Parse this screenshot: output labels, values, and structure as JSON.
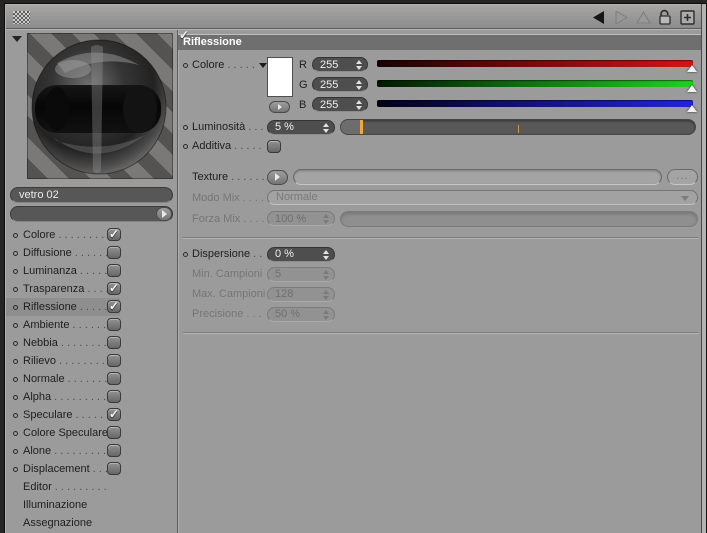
{
  "topbar": {
    "icons": {
      "back": "left-triangle",
      "forward": "right-triangle-disabled",
      "up": "up-triangle-disabled",
      "lock": "open-padlock",
      "add": "plus-box"
    }
  },
  "sidebar": {
    "material_name": "vetro 02",
    "preview": "glass sphere with black cylinder on diagonal stripes",
    "channels": [
      {
        "label": "Colore",
        "dots": ". . . . . . . . .",
        "checked": true
      },
      {
        "label": "Diffusione",
        "dots": ". . . . . .",
        "checked": false
      },
      {
        "label": "Luminanza",
        "dots": ". . . . .",
        "checked": false
      },
      {
        "label": "Trasparenza",
        "dots": ". . . .",
        "checked": true
      },
      {
        "label": "Riflessione",
        "dots": ". . . . .",
        "checked": true,
        "selected": true
      },
      {
        "label": "Ambiente",
        "dots": ". . . . . .",
        "checked": false
      },
      {
        "label": "Nebbia",
        "dots": ". . . . . . . .",
        "checked": false
      },
      {
        "label": "Rilievo",
        "dots": ". . . . . . . .",
        "checked": false
      },
      {
        "label": "Normale",
        "dots": ". . . . . . .",
        "checked": false
      },
      {
        "label": "Alpha",
        "dots": ". . . . . . . . .",
        "checked": false
      },
      {
        "label": "Speculare",
        "dots": ". . . . . .",
        "checked": true
      },
      {
        "label": "Colore Speculare",
        "dots": "",
        "checked": false
      },
      {
        "label": "Alone",
        "dots": ". . . . . . . . .",
        "checked": false
      },
      {
        "label": "Displacement",
        "dots": ". . .",
        "checked": false
      },
      {
        "label": "Editor",
        "dots": ". . . . . . . . ."
      },
      {
        "label": "Illuminazione",
        "dots": ""
      },
      {
        "label": "Assegnazione",
        "dots": ""
      }
    ]
  },
  "panel": {
    "title": "Riflessione",
    "color": {
      "label": "Colore",
      "dots": ". . . . .",
      "swatch_style": "background:#ffffff",
      "r_label": "R",
      "r_value": "255",
      "g_label": "G",
      "g_value": "255",
      "b_label": "B",
      "b_value": "255"
    },
    "luminosita": {
      "label": "Luminosità",
      "dots": ". . .",
      "value": "5 %",
      "slider_pos_pct": 5
    },
    "additiva": {
      "label": "Additiva",
      "dots": ". . . . .",
      "checked": true
    },
    "texture": {
      "label": "Texture",
      "dots": ". . . . . .",
      "value": "",
      "browse_label": "..."
    },
    "modo_mix": {
      "label": "Modo Mix",
      "dots": ". . . .",
      "value": "Normale",
      "disabled": true
    },
    "forza_mix": {
      "label": "Forza Mix",
      "dots": ". . . .",
      "value": "100 %",
      "disabled": true
    },
    "dispersione": {
      "label": "Dispersione",
      "dots": ". .",
      "value": "0 %"
    },
    "min_campioni": {
      "label": "Min. Campioni",
      "dots": "",
      "value": "5",
      "disabled": true
    },
    "max_campioni": {
      "label": "Max. Campioni",
      "dots": "",
      "value": "128",
      "disabled": true
    },
    "precisione": {
      "label": "Precisione",
      "dots": ". . .",
      "value": "50 %",
      "disabled": true
    }
  },
  "colors": {
    "panel_bg": "#9b9b9b",
    "header_bg": "#6f6f6f",
    "field_bg": "#4e4e4e",
    "slider_handle_orange": "#efa93b",
    "red_max": "#d51414",
    "green_max": "#1ed31e",
    "blue_max": "#2323dc"
  }
}
